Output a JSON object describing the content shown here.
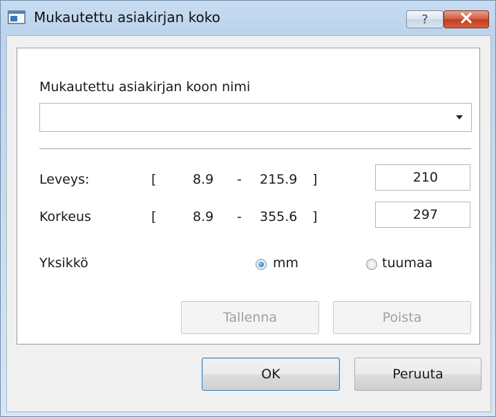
{
  "window": {
    "title": "Mukautettu asiakirjan koko",
    "help_label": "?"
  },
  "form": {
    "name_label": "Mukautettu asiakirjan koon nimi",
    "name_value": "",
    "width": {
      "label": "Leveys:",
      "bracket_open": "[",
      "min": "8.9",
      "dash": "-",
      "max": "215.9",
      "bracket_close": "]",
      "value": "210"
    },
    "height": {
      "label": "Korkeus",
      "bracket_open": "[",
      "min": "8.9",
      "dash": "-",
      "max": "355.6",
      "bracket_close": "]",
      "value": "297"
    },
    "unit": {
      "label": "Yksikkö",
      "options": [
        {
          "label": "mm",
          "checked": true
        },
        {
          "label": "tuumaa",
          "checked": false
        }
      ]
    },
    "save_label": "Tallenna",
    "delete_label": "Poista"
  },
  "footer": {
    "ok_label": "OK",
    "cancel_label": "Peruuta"
  }
}
